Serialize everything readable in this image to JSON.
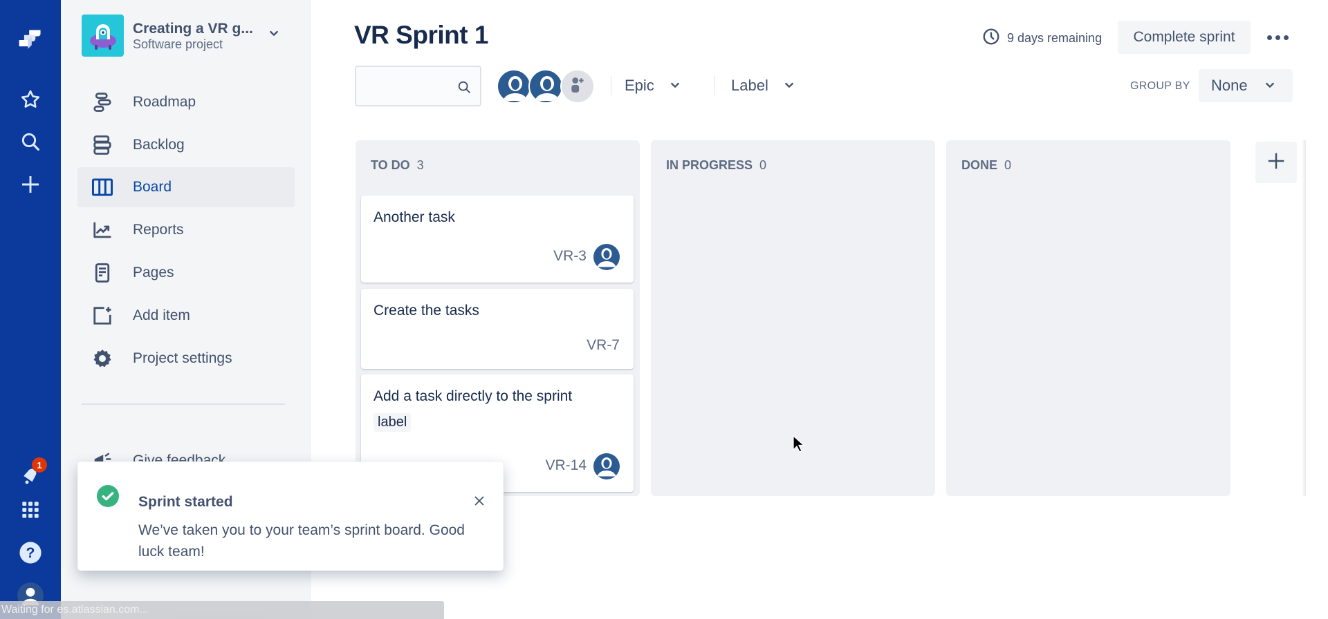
{
  "global_nav": {
    "notifications_count": "1",
    "icons": [
      "jira-logo-icon",
      "star-icon",
      "search-icon",
      "create-icon",
      "notifications-icon",
      "app-switcher-icon",
      "help-icon",
      "profile-icon"
    ]
  },
  "project": {
    "name": "Creating a VR g...",
    "type": "Software project"
  },
  "sidebar": {
    "items": [
      {
        "label": "Roadmap",
        "icon": "roadmap-icon"
      },
      {
        "label": "Backlog",
        "icon": "backlog-icon"
      },
      {
        "label": "Board",
        "icon": "board-icon",
        "active": true
      },
      {
        "label": "Reports",
        "icon": "reports-icon"
      },
      {
        "label": "Pages",
        "icon": "pages-icon"
      },
      {
        "label": "Add item",
        "icon": "add-item-icon"
      },
      {
        "label": "Project settings",
        "icon": "gear-icon"
      }
    ],
    "feedback_label": "Give feedback"
  },
  "header": {
    "title": "VR Sprint 1",
    "remaining": "9 days remaining",
    "complete_label": "Complete sprint"
  },
  "filters": {
    "search_value": "",
    "search_placeholder": "",
    "epic_label": "Epic",
    "label_label": "Label",
    "group_by_label": "GROUP BY",
    "group_by_value": "None"
  },
  "board": {
    "columns": [
      {
        "name": "TO DO",
        "count": "3",
        "cards": [
          {
            "summary": "Another task",
            "key": "VR-3",
            "assignee": true
          },
          {
            "summary": "Create the tasks",
            "key": "VR-7",
            "assignee": false
          },
          {
            "summary": "Add a task directly to the sprint",
            "label": "label",
            "key": "VR-14",
            "assignee": true
          }
        ]
      },
      {
        "name": "IN PROGRESS",
        "count": "0",
        "cards": []
      },
      {
        "name": "DONE",
        "count": "0",
        "cards": []
      }
    ]
  },
  "toast": {
    "title": "Sprint started",
    "body": "We’ve taken you to your team’s sprint board. Good luck team!",
    "status_color": "#36b37e"
  },
  "status_bar": {
    "text": "Waiting for es.atlassian.com..."
  },
  "colors": {
    "nav_bg": "#0b3a9c",
    "active_link": "#0747a6",
    "badge": "#de350b"
  }
}
